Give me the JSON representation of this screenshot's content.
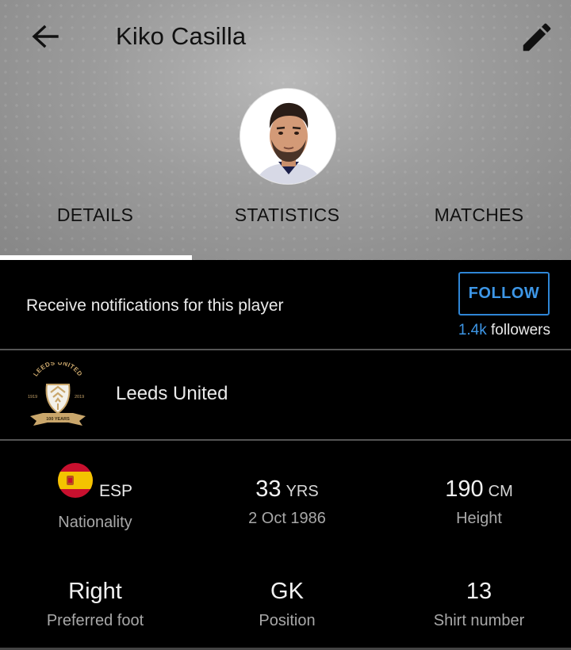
{
  "header": {
    "title": "Kiko Casilla",
    "back_icon": "arrow-left-icon",
    "edit_icon": "pencil-icon"
  },
  "tabs": [
    {
      "label": "DETAILS",
      "selected": true
    },
    {
      "label": "STATISTICS",
      "selected": false
    },
    {
      "label": "MATCHES",
      "selected": false
    }
  ],
  "notifications": {
    "text": "Receive notifications for this player",
    "follow_label": "FOLLOW",
    "followers_count": "1.4k",
    "followers_suffix": " followers"
  },
  "club": {
    "name": "Leeds United",
    "crest_text_top": "LEEDS UNITED",
    "crest_year_left": "1919",
    "crest_year_right": "2019",
    "crest_banner": "100 YEARS"
  },
  "stats": {
    "nationality": {
      "code": "ESP",
      "label": "Nationality"
    },
    "age": {
      "value": "33",
      "unit": "YRS",
      "label": "2 Oct 1986"
    },
    "height": {
      "value": "190",
      "unit": "CM",
      "label": "Height"
    },
    "foot": {
      "value": "Right",
      "label": "Preferred foot"
    },
    "position": {
      "value": "GK",
      "label": "Position"
    },
    "shirt": {
      "value": "13",
      "label": "Shirt number"
    }
  },
  "colors": {
    "accent": "#3d96e6",
    "background": "#000000",
    "header_gray": "#9c9c9c"
  }
}
